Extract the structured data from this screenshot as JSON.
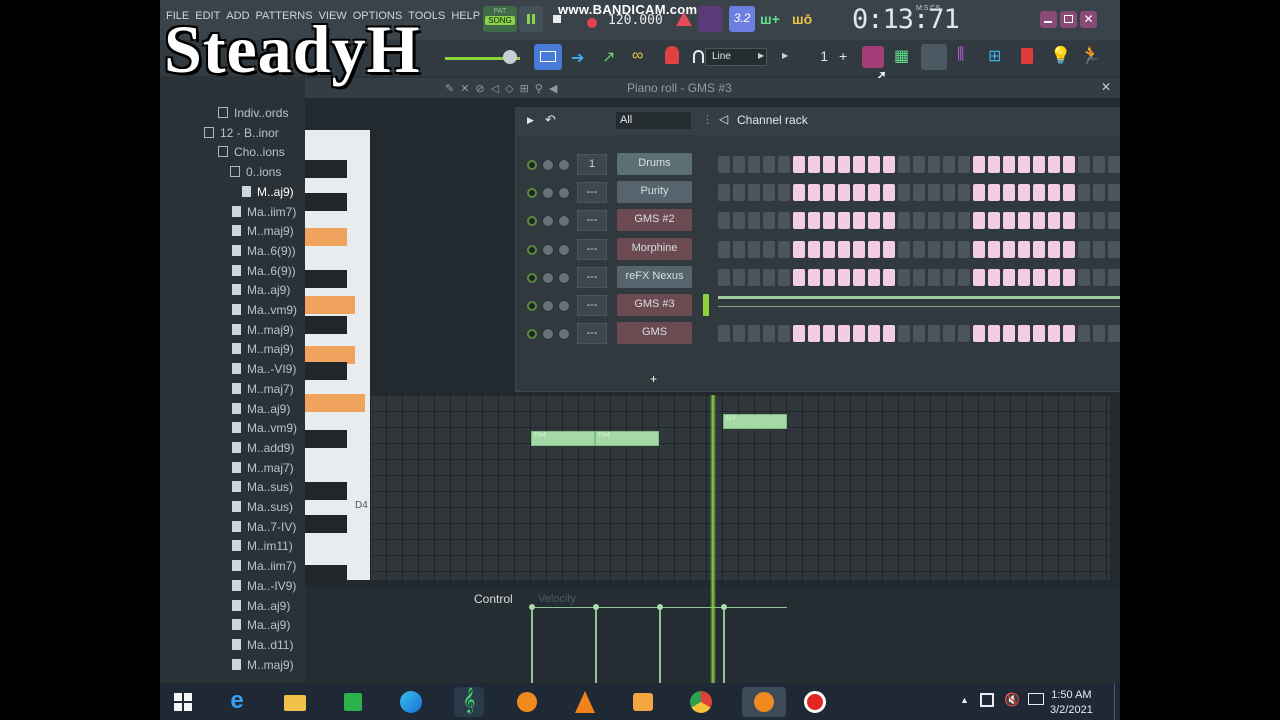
{
  "logo_text": "SteadyH",
  "menu": [
    "FILE",
    "EDIT",
    "ADD",
    "PATTERNS",
    "VIEW",
    "OPTIONS",
    "TOOLS",
    "HELP"
  ],
  "transport": {
    "mode_top": "PAT",
    "mode_bottom": "SONG",
    "tempo": "120.000",
    "watermark": "www.BANDICAM.com",
    "time": "0:13:71",
    "time_unit": "M:S:CS",
    "cpu": "3.2"
  },
  "toolbar": {
    "snap": "Line",
    "step": "1"
  },
  "piano_roll": {
    "title": "Piano roll - GMS #3",
    "key_label": "D4",
    "notes": [
      "F#4",
      "F#4",
      "G4"
    ],
    "control_label": "Control",
    "control_target": "Velocity"
  },
  "channel_rack": {
    "filter": "All",
    "title": "Channel rack",
    "channels": [
      {
        "name": "Drums",
        "mixer": "1",
        "color": "#5b6f74",
        "pattern": "steps"
      },
      {
        "name": "Purity",
        "mixer": "---",
        "color": "#56646d",
        "pattern": "steps"
      },
      {
        "name": "GMS #2",
        "mixer": "---",
        "color": "#6b4a52",
        "pattern": "steps"
      },
      {
        "name": "Morphine",
        "mixer": "---",
        "color": "#6b4a52",
        "pattern": "steps"
      },
      {
        "name": "reFX Nexus",
        "mixer": "---",
        "color": "#56646d",
        "pattern": "steps"
      },
      {
        "name": "GMS #3",
        "mixer": "---",
        "color": "#6b4a52",
        "pattern": "roll"
      },
      {
        "name": "GMS",
        "mixer": "---",
        "color": "#6b4a52",
        "pattern": "steps"
      }
    ],
    "step_pattern": [
      0,
      0,
      0,
      0,
      0,
      1,
      1,
      1,
      1,
      1,
      1,
      1,
      0,
      0,
      0,
      0,
      0,
      1,
      1,
      1,
      1,
      1,
      1,
      1,
      0,
      0,
      0,
      0,
      0,
      1,
      1,
      1,
      1,
      1,
      1,
      1,
      0,
      0,
      0,
      0,
      0,
      1,
      1,
      1,
      1,
      1,
      1,
      1,
      0,
      0,
      0,
      0,
      0,
      1,
      1,
      1,
      1
    ]
  },
  "browser": {
    "items": [
      {
        "label": "Indiv..ords",
        "type": "folder"
      },
      {
        "label": "12 - B..inor",
        "type": "folder"
      },
      {
        "label": "Cho..ions",
        "type": "folder"
      },
      {
        "label": "0..ions",
        "type": "folder"
      },
      {
        "label": "M..aj9)",
        "type": "file",
        "selected": true
      },
      {
        "label": "Ma..iim7)",
        "type": "file"
      },
      {
        "label": "M..maj9)",
        "type": "file"
      },
      {
        "label": "Ma..6(9))",
        "type": "file"
      },
      {
        "label": "Ma..6(9))",
        "type": "file"
      },
      {
        "label": "Ma..aj9)",
        "type": "file"
      },
      {
        "label": "Ma..vm9)",
        "type": "file"
      },
      {
        "label": "M..maj9)",
        "type": "file"
      },
      {
        "label": "M..maj9)",
        "type": "file"
      },
      {
        "label": "Ma..-VI9)",
        "type": "file"
      },
      {
        "label": "M..maj7)",
        "type": "file"
      },
      {
        "label": "Ma..aj9)",
        "type": "file"
      },
      {
        "label": "Ma..vm9)",
        "type": "file"
      },
      {
        "label": "M..add9)",
        "type": "file"
      },
      {
        "label": "M..maj7)",
        "type": "file"
      },
      {
        "label": "Ma..sus)",
        "type": "file"
      },
      {
        "label": "Ma..sus)",
        "type": "file"
      },
      {
        "label": "Ma..7-IV)",
        "type": "file"
      },
      {
        "label": "M..im11)",
        "type": "file"
      },
      {
        "label": "Ma..iim7)",
        "type": "file"
      },
      {
        "label": "Ma..-IV9)",
        "type": "file"
      },
      {
        "label": "Ma..aj9)",
        "type": "file"
      },
      {
        "label": "Ma..aj9)",
        "type": "file"
      },
      {
        "label": "Ma..d11)",
        "type": "file"
      },
      {
        "label": "M..maj9)",
        "type": "file"
      }
    ]
  },
  "taskbar": {
    "clock_time": "1:50 AM",
    "clock_date": "3/2/2021"
  }
}
